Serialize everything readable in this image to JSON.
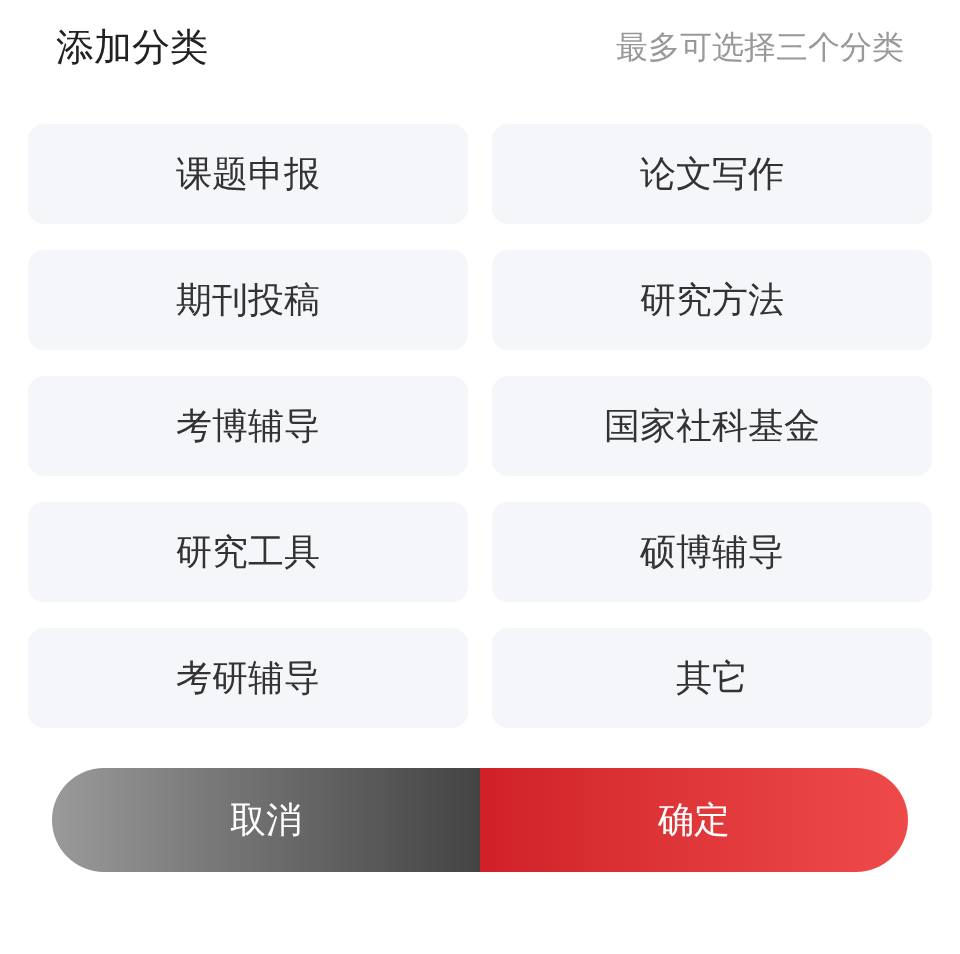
{
  "header": {
    "title": "添加分类",
    "hint": "最多可选择三个分类"
  },
  "categories": [
    {
      "label": "课题申报"
    },
    {
      "label": "论文写作"
    },
    {
      "label": "期刊投稿"
    },
    {
      "label": "研究方法"
    },
    {
      "label": "考博辅导"
    },
    {
      "label": "国家社科基金"
    },
    {
      "label": "研究工具"
    },
    {
      "label": "硕博辅导"
    },
    {
      "label": "考研辅导"
    },
    {
      "label": "其它"
    }
  ],
  "buttons": {
    "cancel": "取消",
    "confirm": "确定"
  }
}
